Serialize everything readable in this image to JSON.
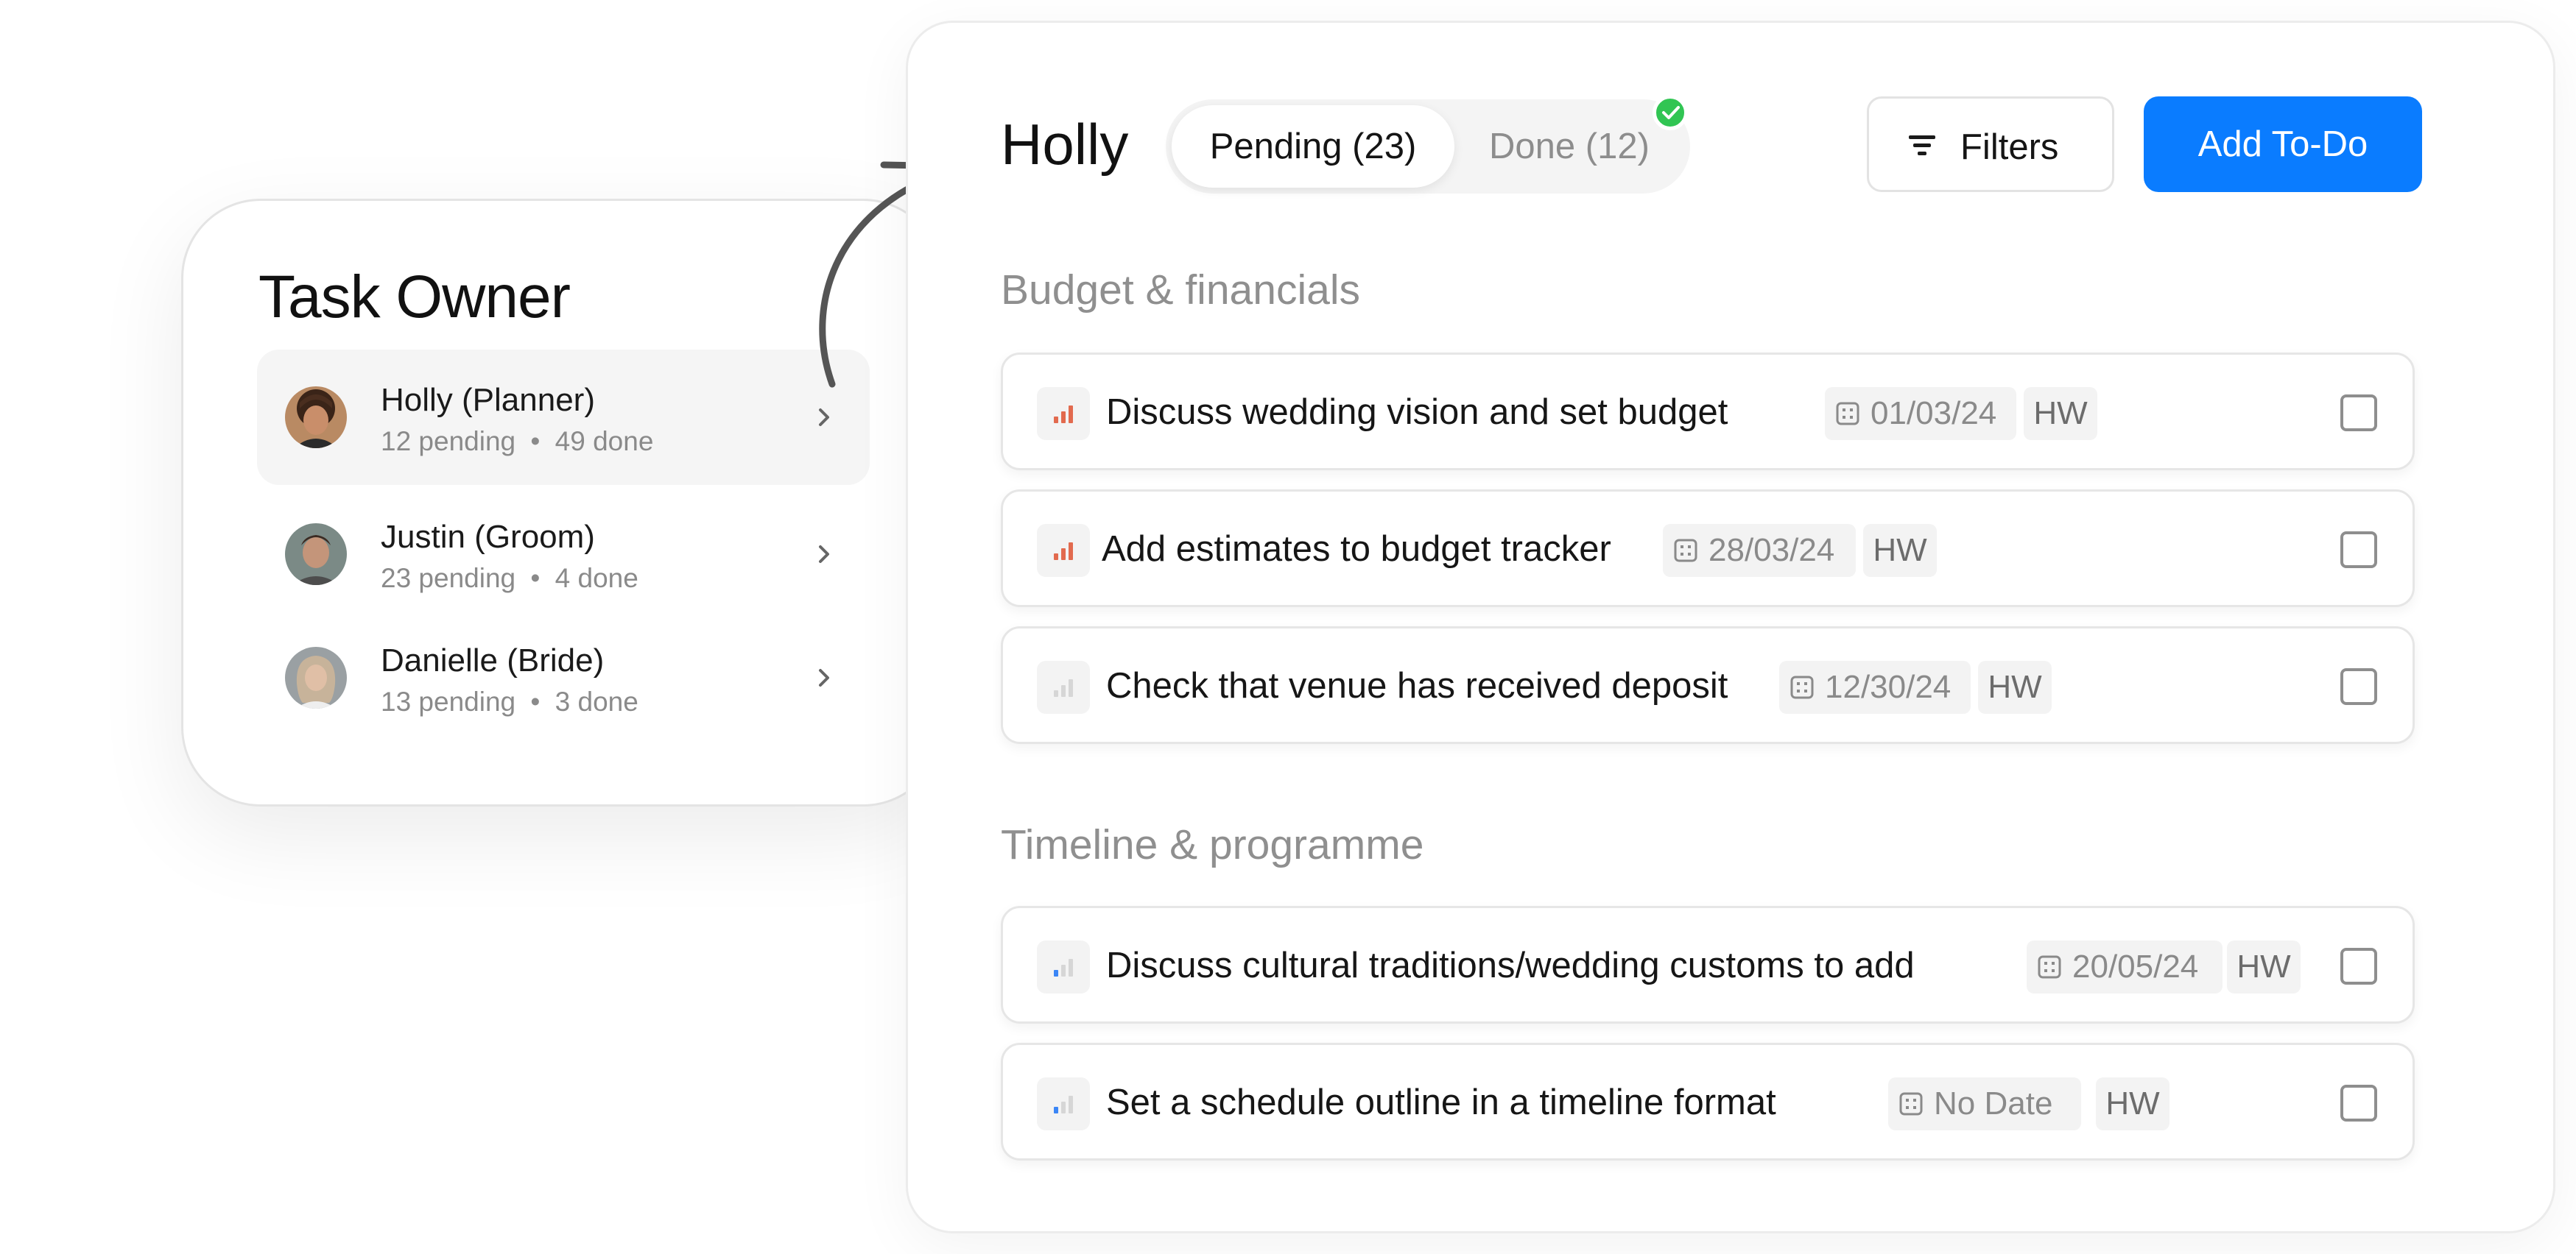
{
  "owner_card": {
    "title": "Task Owner",
    "owners": [
      {
        "name": "Holly (Planner)",
        "pending": "12 pending",
        "done": "49 done",
        "active": true
      },
      {
        "name": "Justin (Groom)",
        "pending": "23 pending",
        "done": "4 done",
        "active": false
      },
      {
        "name": "Danielle (Bride)",
        "pending": "13 pending",
        "done": "3 done",
        "active": false
      }
    ],
    "separator": "•"
  },
  "panel": {
    "title": "Holly",
    "tabs": {
      "pending": "Pending (23)",
      "done": "Done (12)"
    },
    "filters_label": "Filters",
    "add_label": "Add To-Do",
    "accent": "#0a7cff",
    "success": "#31c553"
  },
  "sections": [
    {
      "title": "Budget & financials",
      "tasks": [
        {
          "text": "Discuss wedding vision and set budget",
          "date": "01/03/24",
          "initials": "HW",
          "priority": "high",
          "priority_color": "#e26a4e",
          "checked": false
        },
        {
          "text": "Add estimates to budget tracker",
          "date": "28/03/24",
          "initials": "HW",
          "priority": "high",
          "priority_color": "#e26a4e",
          "checked": false
        },
        {
          "text": "Check that venue has received deposit",
          "date": "12/30/24",
          "initials": "HW",
          "priority": "none",
          "priority_color": "#d6d6d6",
          "checked": false
        }
      ]
    },
    {
      "title": "Timeline & programme",
      "tasks": [
        {
          "text": "Discuss cultural traditions/wedding customs to add",
          "date": "20/05/24",
          "initials": "HW",
          "priority": "low",
          "priority_color": "#3b86f6",
          "checked": false
        },
        {
          "text": "Set a schedule outline in a timeline format",
          "date": "No Date",
          "initials": "HW",
          "priority": "low",
          "priority_color": "#3b86f6",
          "checked": false
        }
      ]
    }
  ]
}
